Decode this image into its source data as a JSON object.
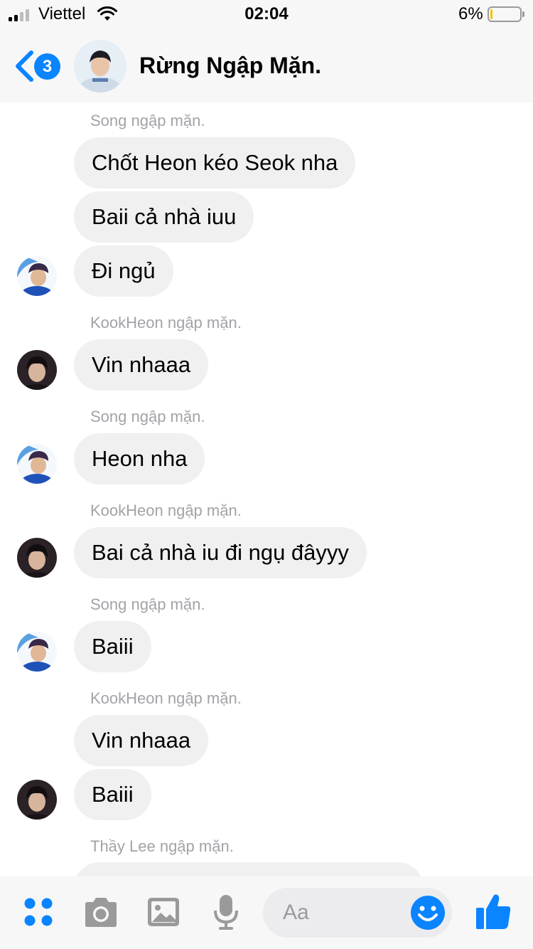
{
  "status_bar": {
    "carrier": "Viettel",
    "time": "02:04",
    "battery_percent": "6%",
    "battery_level": 0.06
  },
  "header": {
    "back_badge": "3",
    "title": "Rừng Ngập Mặn."
  },
  "messages": [
    {
      "sender_label": "Song ngập mặn.",
      "bubbles": [
        "Chốt Heon kéo Seok nha",
        "Baii cả nhà iuu",
        "Đi ngủ"
      ]
    },
    {
      "sender_label": "KookHeon ngập mặn.",
      "bubbles": [
        "Vin nhaaa"
      ]
    },
    {
      "sender_label": "Song ngập mặn.",
      "bubbles": [
        "Heon nha"
      ]
    },
    {
      "sender_label": "KookHeon ngập mặn.",
      "bubbles": [
        "Bai cả nhà iu đi ngụ đâyyy"
      ]
    },
    {
      "sender_label": "Song ngập mặn.",
      "bubbles": [
        "Baiii"
      ]
    },
    {
      "sender_label": "KookHeon ngập mặn.",
      "bubbles": [
        "Vin nhaaa",
        "Baiii"
      ]
    },
    {
      "sender_label": "Thầy Lee ngập mặn.",
      "bubbles": []
    }
  ],
  "composer": {
    "placeholder": "Aa"
  },
  "icons": [
    "signal-icon",
    "wifi-icon",
    "battery-icon",
    "back-chevron-icon",
    "apps-grid-icon",
    "camera-icon",
    "gallery-icon",
    "microphone-icon",
    "emoji-icon",
    "thumbs-up-icon"
  ],
  "colors": {
    "accent": "#0a84ff",
    "bubble": "#f0f0f1",
    "sender_label": "#a3a3a8"
  }
}
